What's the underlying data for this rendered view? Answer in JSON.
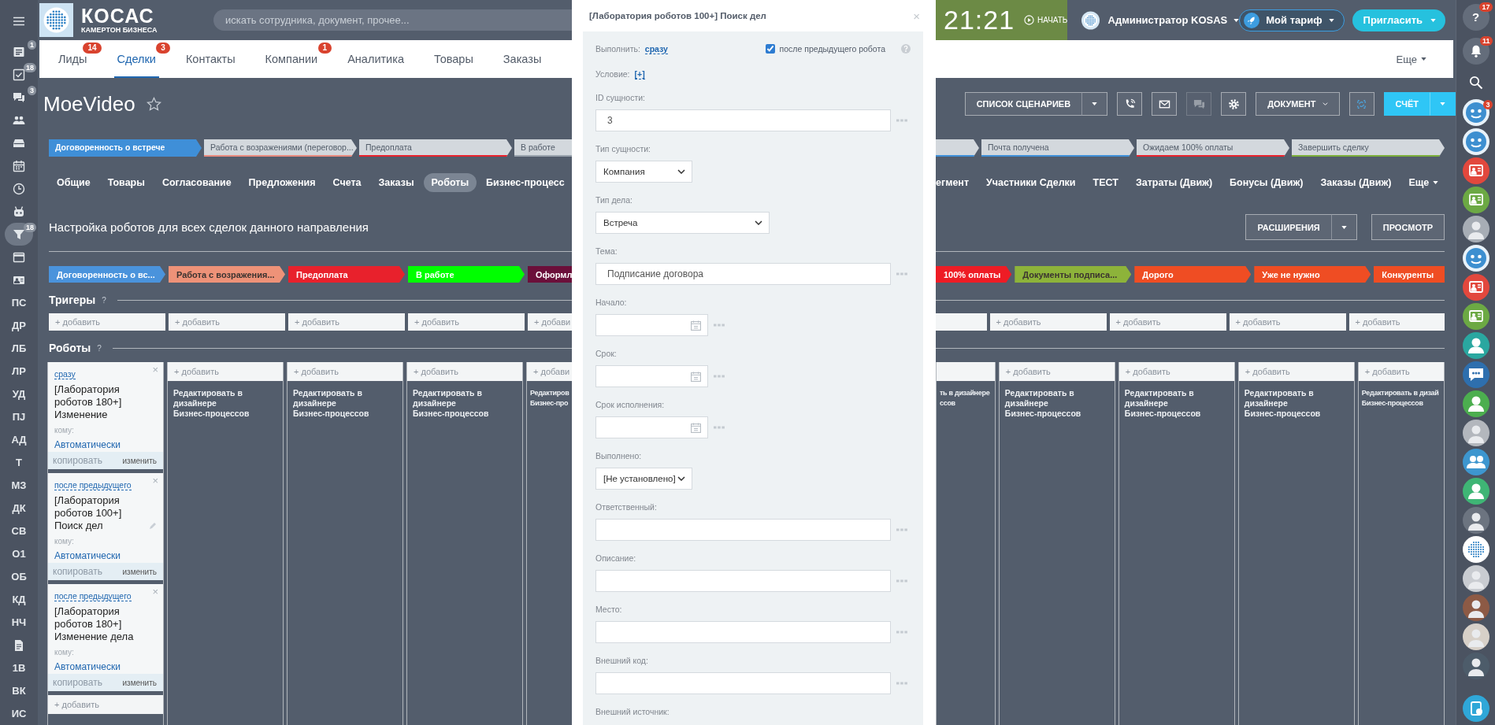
{
  "left_sidebar": {
    "items": [
      {
        "kind": "menu",
        "selected": false
      },
      {
        "kind": "list",
        "badge": "1",
        "selected": false
      },
      {
        "kind": "tasks",
        "badge": "18",
        "selected": false
      },
      {
        "kind": "chat",
        "badge": "3",
        "selected": false
      },
      {
        "kind": "team",
        "selected": false
      },
      {
        "kind": "drive",
        "selected": false
      },
      {
        "kind": "calendar",
        "selected": false
      },
      {
        "kind": "clock",
        "selected": false
      },
      {
        "kind": "robot",
        "selected": false
      },
      {
        "kind": "funnel",
        "badge": "18",
        "selected": true
      },
      {
        "kind": "window",
        "selected": false
      },
      {
        "kind": "card",
        "selected": false
      },
      {
        "kind": "text",
        "label": "ПС",
        "selected": false
      },
      {
        "kind": "text",
        "label": "ДР",
        "selected": false
      },
      {
        "kind": "text",
        "label": "ЛБ",
        "selected": false
      },
      {
        "kind": "text",
        "label": "ЛР",
        "selected": false
      },
      {
        "kind": "text",
        "label": "УД",
        "selected": false
      },
      {
        "kind": "text",
        "label": "ПЈ",
        "selected": false
      },
      {
        "kind": "text",
        "label": "АД",
        "selected": false
      },
      {
        "kind": "text",
        "label": "Т",
        "selected": false
      },
      {
        "kind": "text",
        "label": "МЗ",
        "selected": false
      },
      {
        "kind": "text",
        "label": "ДК",
        "selected": false
      },
      {
        "kind": "text",
        "label": "СВ",
        "selected": false
      },
      {
        "kind": "text",
        "label": "О1",
        "selected": false
      },
      {
        "kind": "text",
        "label": "ОБ",
        "selected": false
      },
      {
        "kind": "text",
        "label": "КД",
        "selected": false
      },
      {
        "kind": "text",
        "label": "НЧ",
        "selected": false
      },
      {
        "kind": "doc",
        "selected": false
      },
      {
        "kind": "text",
        "label": "1В",
        "selected": false
      },
      {
        "kind": "text",
        "label": "ВК",
        "selected": false
      },
      {
        "kind": "text",
        "label": "ИС",
        "selected": false
      }
    ]
  },
  "header": {
    "logo": {
      "name": "КОСАС",
      "tagline": "КАМЕРТОН БИЗНЕСА"
    },
    "search": {
      "placeholder": "искать сотрудника, документ, прочее..."
    },
    "timer": {
      "time": "21:21",
      "action": "НАЧАТЬ"
    },
    "user": {
      "name": "Администратор KOSAS"
    },
    "tariff": "Мой тариф",
    "invite": "Пригласить"
  },
  "nav": {
    "tabs": [
      {
        "label": "Лиды",
        "badge": "14",
        "selected": false
      },
      {
        "label": "Сделки",
        "badge": "3",
        "selected": true
      },
      {
        "label": "Контакты",
        "selected": false
      },
      {
        "label": "Компании",
        "badge": "1",
        "selected": false
      },
      {
        "label": "Аналитика",
        "selected": false
      },
      {
        "label": "Товары",
        "selected": false
      },
      {
        "label": "Заказы",
        "selected": false
      }
    ],
    "more": "Еще"
  },
  "deal": {
    "title": "MoeVideo",
    "favorite": false,
    "toolbar": [
      {
        "kind": "split",
        "label": "СПИСОК СЦЕНАРИЕВ",
        "disabled": false
      },
      {
        "kind": "phone",
        "disabled": false
      },
      {
        "kind": "mail",
        "disabled": false
      },
      {
        "kind": "chat",
        "disabled": true
      },
      {
        "kind": "settings",
        "disabled": false
      },
      {
        "kind": "dropdown",
        "label": "ДОКУМЕНТ",
        "disabled": false
      },
      {
        "kind": "refresh",
        "disabled": false
      },
      {
        "kind": "primary-split",
        "label": "СЧЁТ",
        "disabled": false
      }
    ]
  },
  "pipeline": {
    "left": [
      {
        "kind": "full",
        "label": "Договоренность о встрече",
        "color": "#3f8fd8",
        "selected": true
      },
      {
        "kind": "full",
        "label": "Работа с возражениями (переговор...",
        "color": "#e98a7e",
        "selected": false
      },
      {
        "kind": "full",
        "label": "Предоплата",
        "color": "#e8212c",
        "selected": false
      },
      {
        "kind": "partial",
        "label": "В работе",
        "color": "#9aa3ad",
        "selected": false
      }
    ],
    "right": [
      {
        "kind": "partial",
        "color": "#3f8fd8",
        "selected": false
      },
      {
        "kind": "full",
        "label": "Почта получена",
        "color": "#3f8fd8",
        "selected": false
      },
      {
        "kind": "full",
        "label": "Ожидаем 100% оплаты",
        "color": "#e8212c",
        "selected": false
      },
      {
        "kind": "full",
        "label": "Завершить сделку",
        "color": "#7cae3a",
        "selected": false
      }
    ]
  },
  "deal_tabs": {
    "left": [
      {
        "label": "Общие",
        "selected": false
      },
      {
        "label": "Товары",
        "selected": false
      },
      {
        "label": "Согласование",
        "selected": false
      },
      {
        "label": "Предложения",
        "selected": false
      },
      {
        "label": "Счета",
        "selected": false
      },
      {
        "label": "Заказы",
        "selected": false
      },
      {
        "label": "Роботы",
        "selected": true
      },
      {
        "label": "Бизнес-процесс",
        "selected": false
      }
    ],
    "right": [
      {
        "label": "егмент",
        "selected": false
      },
      {
        "label": "Участники Сделки",
        "selected": false
      },
      {
        "label": "ТЕСТ",
        "selected": false
      },
      {
        "label": "Затраты (Движ)",
        "selected": false
      },
      {
        "label": "Бонусы (Движ)",
        "selected": false
      },
      {
        "label": "Заказы (Движ)",
        "selected": false
      }
    ],
    "more": "Еще"
  },
  "robots": {
    "heading": "Настройка роботов для всех сделок данного направления",
    "extensions": "РАСШИРЕНИЯ",
    "preview": "ПРОСМОТР",
    "triggers_label": "Тригеры",
    "robots_label": "Роботы",
    "hint": "?",
    "left_columns": [
      {
        "kind": "full",
        "stage": "Договоренность о вс...",
        "color": "#4a93dc",
        "trigger_add": "+ добавить",
        "robot_add": "+ добавить",
        "robots": [
          {
            "timing": "сразу",
            "title": "[Лаборатория роботов 180+] Изменение",
            "to_label": "кому:",
            "to": "Автоматически",
            "copy": "копировать",
            "copy_disabled": true,
            "edit": "изменить",
            "close": "×",
            "pencil": false
          },
          {
            "timing": "после предыдущего",
            "title": "[Лаборатория роботов 100+] Поиск дел",
            "to_label": "кому:",
            "to": "Автоматически",
            "copy": "копировать",
            "copy_disabled": true,
            "edit": "изменить",
            "close": "×",
            "pencil": true
          },
          {
            "timing": "после предыдущего",
            "title": "[Лаборатория роботов 180+] Изменение дела",
            "to_label": "кому:",
            "to": "Автоматически",
            "copy": "копировать",
            "copy_disabled": true,
            "edit": "изменить",
            "close": "×",
            "pencil": false
          }
        ]
      },
      {
        "kind": "full",
        "stage": "Работа с возражения...",
        "color": "#ee9278",
        "trigger_add": "+ добавить",
        "robot_add": "+ добавить",
        "designer": [
          "Редактировать в дизайнере",
          "Бизнес-процессов"
        ]
      },
      {
        "kind": "full",
        "stage": "Предоплата",
        "color": "#e8212c",
        "trigger_add": "+ добавить",
        "robot_add": "+ добавить",
        "designer": [
          "Редактировать в дизайнере",
          "Бизнес-процессов"
        ]
      },
      {
        "kind": "full",
        "stage": "В работе",
        "color": "#00ff00",
        "trigger_add": "+ добавить",
        "robot_add": "+ добавить",
        "designer": [
          "Редактировать в дизайнере",
          "Бизнес-процессов"
        ]
      },
      {
        "kind": "partial",
        "stage": "Оформл",
        "color": "#6b0f3a",
        "trigger_add": "+ добави",
        "robot_add": "+ добави",
        "designer": [
          "Редактиров",
          "Бизнес-про"
        ]
      }
    ],
    "right_columns": [
      {
        "kind": "partial",
        "stage": "100% оплаты",
        "color": "#ee1c25",
        "designer": [
          "ть в дизайнере",
          "ссов"
        ]
      },
      {
        "kind": "full",
        "stage": "Документы подписа...",
        "color": "#8db33a",
        "trigger_add": "+ добавить",
        "robot_add": "+ добавить",
        "designer": [
          "Редактировать в дизайнере",
          "Бизнес-процессов"
        ]
      },
      {
        "kind": "full",
        "stage": "Дорого",
        "color": "#ef4d23",
        "trigger_add": "+ добавить",
        "robot_add": "+ добавить",
        "designer": [
          "Редактировать в дизайнере",
          "Бизнес-процессов"
        ]
      },
      {
        "kind": "full",
        "stage": "Уже не нужно",
        "color": "#ef4d23",
        "trigger_add": "+ добавить",
        "robot_add": "+ добавить",
        "designer": [
          "Редактировать в дизайнере",
          "Бизнес-процессов"
        ]
      },
      {
        "kind": "partial",
        "stage": "Конкуренты",
        "color": "#ef4d23",
        "trigger_add": "+ добавить",
        "robot_add": "+ добавить",
        "designer": [
          "Редактировать в дизай",
          "Бизнес-процессов"
        ]
      }
    ]
  },
  "modal": {
    "title": "[Лаборатория роботов 100+] Поиск дел",
    "close": "×",
    "run_label": "Выполнить:",
    "run_value": "сразу",
    "after_previous": {
      "label": "после предыдущего робота",
      "checked": true
    },
    "condition_label": "Условие:",
    "condition_value": "[+]",
    "fields": [
      {
        "kind": "text",
        "label": "ID сущности:",
        "value": "3"
      },
      {
        "kind": "select",
        "label": "Тип сущности:",
        "value": "Компания"
      },
      {
        "kind": "wide-select",
        "label": "Тип дела:",
        "value": "Встреча"
      },
      {
        "kind": "text",
        "label": "Тема:",
        "value": "Подписание договора"
      },
      {
        "kind": "date",
        "label": "Начало:"
      },
      {
        "kind": "date",
        "label": "Срок:"
      },
      {
        "kind": "date",
        "label": "Срок исполнения:"
      },
      {
        "kind": "select",
        "label": "Выполнено:",
        "value": "[Не установлено]"
      },
      {
        "kind": "text",
        "label": "Ответственный:"
      },
      {
        "kind": "text",
        "label": "Описание:"
      },
      {
        "kind": "text",
        "label": "Место:"
      },
      {
        "kind": "text",
        "label": "Внешний код:"
      },
      {
        "kind": "label",
        "label": "Внешний источник:"
      }
    ]
  },
  "right_sidebar": {
    "help": {
      "label": "?",
      "badge": "17"
    },
    "notifications": {
      "badge": "11"
    },
    "contacts": [
      {
        "kind": "bot",
        "color": "#e8f2fa",
        "badge": "3"
      },
      {
        "kind": "bot",
        "color": "#e8f2fa"
      },
      {
        "kind": "crm",
        "color": "#e2483d"
      },
      {
        "kind": "crm",
        "color": "#6ca944"
      },
      {
        "kind": "photo",
        "color": "#a7adb5"
      },
      {
        "kind": "bot",
        "color": "#e8f2fa"
      },
      {
        "kind": "crm",
        "color": "#e2483d"
      },
      {
        "kind": "crm",
        "color": "#6ca944"
      },
      {
        "kind": "user",
        "color": "#2aa7a0"
      },
      {
        "kind": "chat",
        "color": "#2e6fae"
      },
      {
        "kind": "user",
        "color": "#4cae4f"
      },
      {
        "kind": "photo",
        "color": "#b3b7bd"
      },
      {
        "kind": "group",
        "color": "#3d96cf"
      },
      {
        "kind": "user",
        "color": "#3fb575"
      },
      {
        "kind": "photo",
        "color": "#6c7480"
      },
      {
        "kind": "logo",
        "color": "#ffffff"
      },
      {
        "kind": "photo",
        "color": "#c9ccd1"
      },
      {
        "kind": "photo",
        "color": "#8d5a45"
      },
      {
        "kind": "photo",
        "color": "#d7d0c8"
      },
      {
        "kind": "photo",
        "color": "#4d5c6a"
      }
    ]
  }
}
